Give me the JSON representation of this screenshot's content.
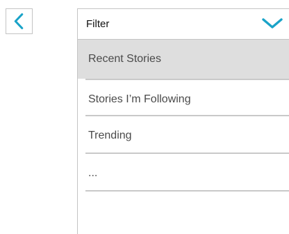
{
  "nav": {
    "back_icon": "chevron-left-icon"
  },
  "filter": {
    "label": "Filter",
    "chevron_icon": "chevron-down-icon",
    "options": [
      {
        "label": "Recent Stories",
        "selected": true
      },
      {
        "label": "Stories I’m Following",
        "selected": false
      },
      {
        "label": "Trending",
        "selected": false
      },
      {
        "label": "...",
        "selected": false
      }
    ]
  },
  "colors": {
    "accent": "#1aa3c8",
    "selected_bg": "#dedede",
    "border": "#c4c4c4"
  }
}
